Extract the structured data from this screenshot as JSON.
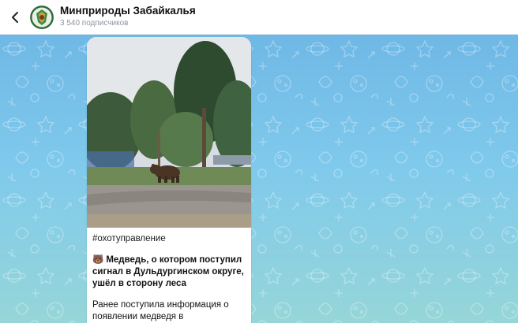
{
  "header": {
    "channel_name": "Минприроды Забайкалья",
    "subscribers": "3 540 подписчиков",
    "back_icon": "chevron-left-icon",
    "avatar_icon": "emblem-avatar"
  },
  "message": {
    "photo_subject": "bear-walking-near-trees",
    "hashtag": "#охотуправление",
    "headline_emoji": "🐻",
    "headline": "Медведь, о котором поступил сигнал в Дульдургинском округе, ушёл в сторону леса",
    "body": "Ранее поступила информация о появлении медведя в Дульдургинском округе. На месте"
  },
  "colors": {
    "chat_bg_top": "#6fb8e6",
    "chat_bg_bottom": "#96d6d8",
    "header_bg": "#ffffff",
    "bubble_bg": "#ffffff"
  }
}
